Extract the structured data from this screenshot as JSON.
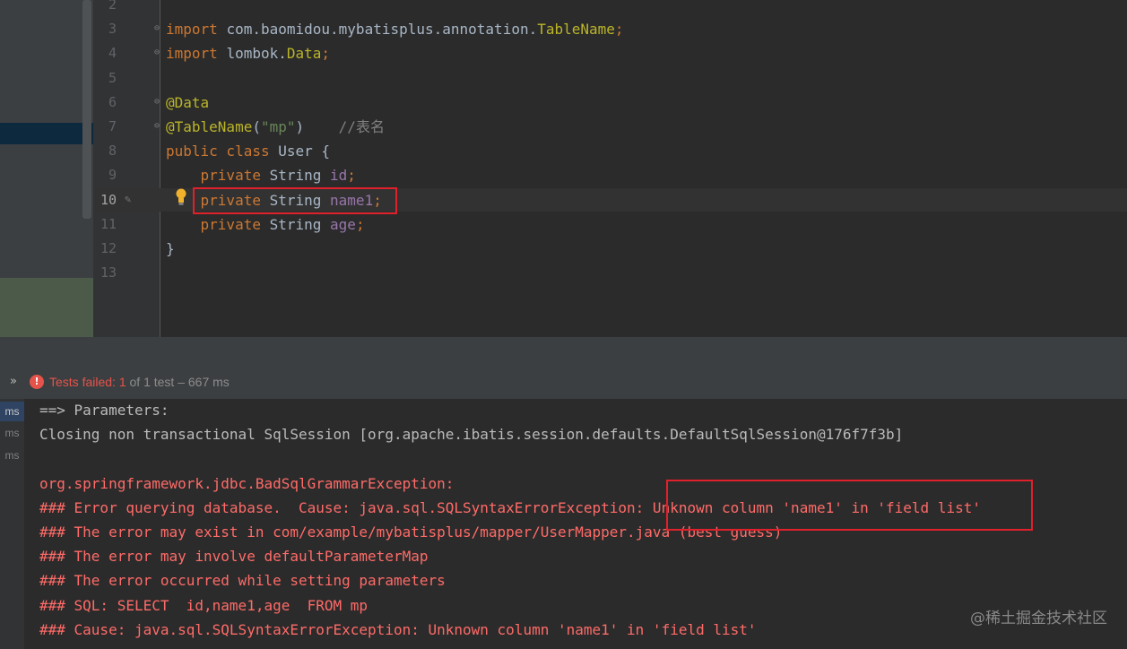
{
  "editor": {
    "lines": [
      {
        "num": "2",
        "code": ""
      },
      {
        "num": "3",
        "parts": [
          [
            "kw",
            "import "
          ],
          [
            "plain",
            "com.baomidou.mybatisplus.annotation."
          ],
          [
            "ann",
            "TableName"
          ],
          [
            "kw",
            ";"
          ]
        ]
      },
      {
        "num": "4",
        "parts": [
          [
            "kw",
            "import "
          ],
          [
            "plain",
            "lombok."
          ],
          [
            "ann",
            "Data"
          ],
          [
            "kw",
            ";"
          ]
        ]
      },
      {
        "num": "5",
        "parts": []
      },
      {
        "num": "6",
        "parts": [
          [
            "ann",
            "@Data"
          ]
        ]
      },
      {
        "num": "7",
        "parts": [
          [
            "ann",
            "@TableName"
          ],
          [
            "plain",
            "("
          ],
          [
            "str",
            "\"mp\""
          ],
          [
            "plain",
            ")    "
          ],
          [
            "cmt",
            "//表名"
          ]
        ]
      },
      {
        "num": "8",
        "parts": [
          [
            "kw",
            "public class "
          ],
          [
            "plain",
            "User {"
          ]
        ]
      },
      {
        "num": "9",
        "parts": [
          [
            "plain",
            "    "
          ],
          [
            "kw",
            "private "
          ],
          [
            "plain",
            "String "
          ],
          [
            "fld",
            "id"
          ],
          [
            "kw",
            ";"
          ]
        ]
      },
      {
        "num": "10",
        "parts": [
          [
            "plain",
            "    "
          ],
          [
            "kw",
            "private "
          ],
          [
            "plain",
            "String "
          ],
          [
            "fld",
            "name1"
          ],
          [
            "kw",
            ";"
          ]
        ]
      },
      {
        "num": "11",
        "parts": [
          [
            "plain",
            "    "
          ],
          [
            "kw",
            "private "
          ],
          [
            "plain",
            "String "
          ],
          [
            "fld",
            "age"
          ],
          [
            "kw",
            ";"
          ]
        ]
      },
      {
        "num": "12",
        "parts": [
          [
            "plain",
            "}"
          ]
        ]
      },
      {
        "num": "13",
        "parts": []
      }
    ]
  },
  "run": {
    "chevron": "»",
    "error_icon": "!",
    "status_failed": "Tests failed: 1",
    "status_rest": " of 1 test – 667 ms"
  },
  "console": {
    "ms_labels": [
      "ms",
      "ms",
      "ms"
    ],
    "lines": [
      {
        "style": "white",
        "text": "==> Parameters: "
      },
      {
        "style": "white",
        "text": "Closing non transactional SqlSession [org.apache.ibatis.session.defaults.DefaultSqlSession@176f7f3b]"
      },
      {
        "style": "white",
        "text": ""
      },
      {
        "style": "red",
        "text": "org.springframework.jdbc.BadSqlGrammarException: "
      },
      {
        "style": "red",
        "text": "### Error querying database.  Cause: java.sql.SQLSyntaxErrorException: Unknown column 'name1' in 'field list'"
      },
      {
        "style": "red",
        "text": "### The error may exist in com/example/mybatisplus/mapper/UserMapper.java (best guess)"
      },
      {
        "style": "red",
        "text": "### The error may involve defaultParameterMap"
      },
      {
        "style": "red",
        "text": "### The error occurred while setting parameters"
      },
      {
        "style": "red",
        "text": "### SQL: SELECT  id,name1,age  FROM mp"
      },
      {
        "style": "red",
        "text": "### Cause: java.sql.SQLSyntaxErrorException: Unknown column 'name1' in 'field list'"
      }
    ]
  },
  "watermark": "@稀土掘金技术社区",
  "colors": {
    "keyword": "#cc7832",
    "annotation": "#bbb529",
    "field": "#9876aa",
    "string": "#6a8759",
    "error_text": "#ff6b68",
    "highlight_box": "#e0202a"
  }
}
